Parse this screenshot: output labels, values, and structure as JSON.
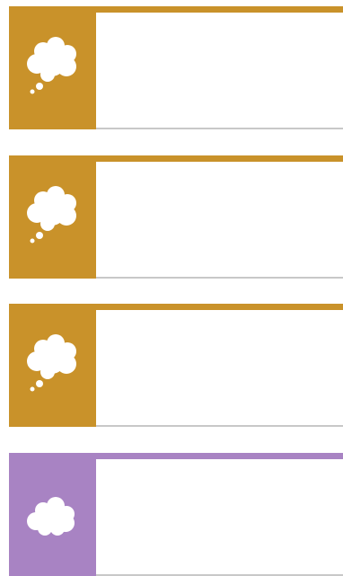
{
  "colors": {
    "think": "#c9922a",
    "say": "#a883c3",
    "line": "#c8c8c8",
    "icon": "#ffffff"
  },
  "blocks": [
    {
      "kind": "think",
      "icon": "thought-bubble-icon",
      "text": ""
    },
    {
      "kind": "think",
      "icon": "thought-bubble-icon",
      "text": ""
    },
    {
      "kind": "think",
      "icon": "thought-bubble-icon",
      "text": ""
    },
    {
      "kind": "say",
      "icon": "speech-cloud-icon",
      "text": ""
    }
  ]
}
